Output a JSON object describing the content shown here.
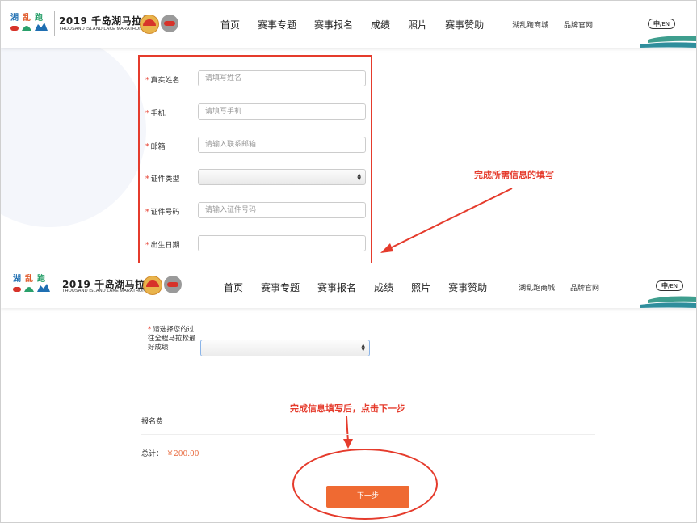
{
  "header": {
    "brand_title": "2019 千岛湖马拉松",
    "brand_subtitle": "THOUSAND ISLAND LAKE MARATHON",
    "nav": [
      "首页",
      "赛事专题",
      "赛事报名",
      "成绩",
      "照片",
      "赛事赞助"
    ],
    "right_links": [
      "湖乱跑商城",
      "品牌官网"
    ],
    "lang": {
      "zh": "中",
      "en": "/EN"
    }
  },
  "form": {
    "fields": [
      {
        "label": "真实姓名",
        "placeholder": "请填写姓名",
        "type": "text"
      },
      {
        "label": "手机",
        "placeholder": "请填写手机",
        "type": "text"
      },
      {
        "label": "邮箱",
        "placeholder": "请输入联系邮箱",
        "type": "text"
      },
      {
        "label": "证件类型",
        "placeholder": "",
        "type": "select"
      },
      {
        "label": "证件号码",
        "placeholder": "请输入证件号码",
        "type": "text"
      },
      {
        "label": "出生日期",
        "placeholder": "",
        "type": "text"
      }
    ],
    "required_mark": "*",
    "best_result_label": "请选择您的过往全程马拉松最好成绩"
  },
  "fee": {
    "title": "报名费",
    "total_label": "总计：",
    "total_amount": "￥200.00"
  },
  "next_button": "下一步",
  "annotations": {
    "fill_info": "完成所需信息的填写",
    "click_next": "完成信息填写后，点击下一步"
  },
  "colors": {
    "accent": "#ef6a32",
    "annotation": "#e53b2c",
    "focus": "#8ab4e8"
  }
}
